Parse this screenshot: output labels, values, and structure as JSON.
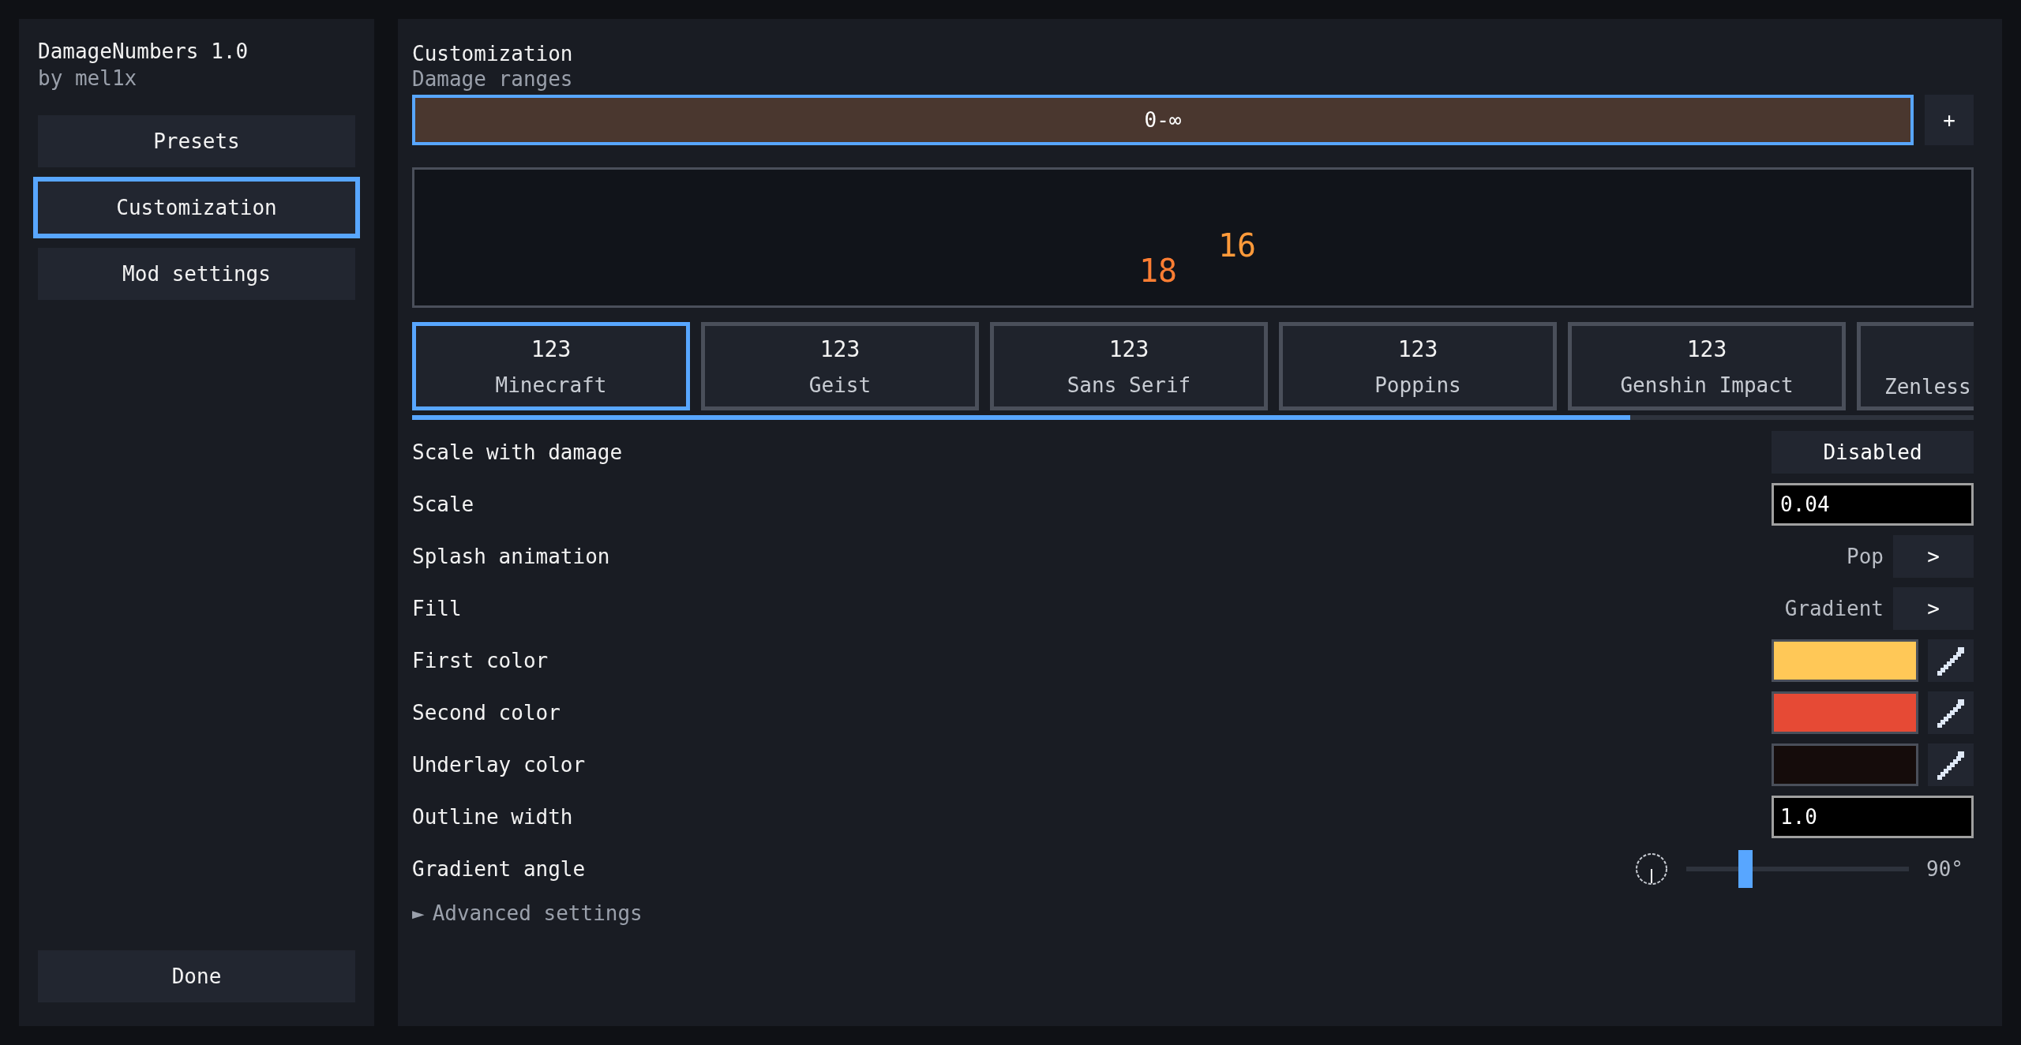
{
  "sidebar": {
    "title": "DamageNumbers 1.0",
    "author": "by mel1x",
    "items": [
      {
        "label": "Presets",
        "selected": false
      },
      {
        "label": "Customization",
        "selected": true
      },
      {
        "label": "Mod settings",
        "selected": false
      }
    ],
    "done": "Done"
  },
  "main": {
    "title": "Customization",
    "subtitle": "Damage ranges",
    "ranges": [
      {
        "label": "0-∞",
        "selected": true,
        "color": "#4a372f"
      }
    ],
    "add_button": "+",
    "preview": {
      "numbers": [
        {
          "text": "18"
        },
        {
          "text": "16"
        }
      ]
    },
    "fonts": [
      {
        "sample": "123",
        "label": "Minecraft",
        "selected": true
      },
      {
        "sample": "123",
        "label": "Geist",
        "selected": false
      },
      {
        "sample": "123",
        "label": "Sans Serif",
        "selected": false
      },
      {
        "sample": "123",
        "label": "Poppins",
        "selected": false
      },
      {
        "sample": "123",
        "label": "Genshin Impact",
        "selected": false
      },
      {
        "label": "Zenless",
        "selected": false
      }
    ],
    "settings": [
      {
        "kind": "toggle",
        "label": "Scale with damage",
        "value": "Disabled"
      },
      {
        "kind": "input",
        "label": "Scale",
        "value": "0.04"
      },
      {
        "kind": "cycle",
        "label": "Splash animation",
        "value": "Pop",
        "button": ">"
      },
      {
        "kind": "cycle",
        "label": "Fill",
        "value": "Gradient",
        "button": ">"
      },
      {
        "kind": "color",
        "label": "First color",
        "color": "#ffc857"
      },
      {
        "kind": "color",
        "label": "Second color",
        "color": "#e64a35"
      },
      {
        "kind": "color",
        "label": "Underlay color",
        "color": "#150c0b"
      },
      {
        "kind": "input",
        "label": "Outline width",
        "value": "1.0"
      },
      {
        "kind": "slider",
        "label": "Gradient angle",
        "level": 0.25,
        "reading": "90°"
      }
    ],
    "advanced": {
      "arrow": "►",
      "label": "Advanced settings",
      "expanded": false
    }
  }
}
